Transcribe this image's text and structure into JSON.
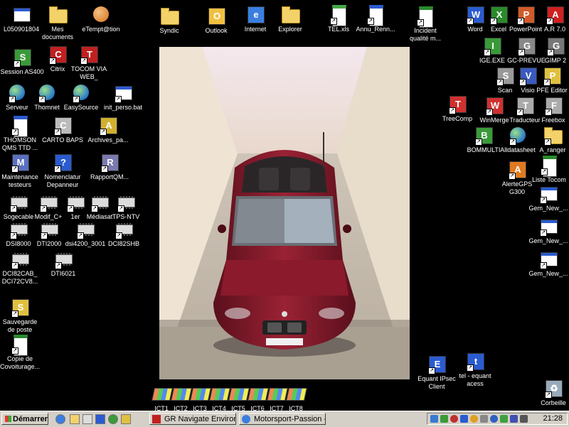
{
  "wallpaper": {
    "subject": "car-photo"
  },
  "icons": [
    {
      "id": "l050901804",
      "label": "L050901804",
      "glyph": "computer",
      "color": "#5b8de0"
    },
    {
      "id": "mes-documents",
      "label": "Mes\ndocuments",
      "glyph": "folder",
      "color": "#f3d26a"
    },
    {
      "id": "etemptation",
      "label": "eTempt@tion",
      "glyph": "people",
      "color": "#e0893a"
    },
    {
      "id": "syndic",
      "label": "Syndic",
      "glyph": "folder",
      "color": "#f3d26a"
    },
    {
      "id": "outlook",
      "label": "Outlook",
      "glyph": "tile",
      "color": "#f0c040",
      "letter": "O"
    },
    {
      "id": "internet",
      "label": "Internet",
      "glyph": "tile",
      "color": "#3b7ee0",
      "letter": "e"
    },
    {
      "id": "explorer",
      "label": "Explorer",
      "glyph": "folder",
      "color": "#f3d26a"
    },
    {
      "id": "tel-xls",
      "label": "TEL.xls",
      "glyph": "phone",
      "color": "#4a4"
    },
    {
      "id": "annu-renn",
      "label": "Annu_Renn...",
      "glyph": "doc",
      "color": "#2a5bd0"
    },
    {
      "id": "incident-qualite",
      "label": "Incident\nqualité m...",
      "glyph": "doc",
      "color": "#2a8a2a"
    },
    {
      "id": "word",
      "label": "Word",
      "glyph": "tile",
      "color": "#2a5bd0",
      "letter": "W"
    },
    {
      "id": "excel",
      "label": "Excel",
      "glyph": "tile",
      "color": "#2a8a2a",
      "letter": "X"
    },
    {
      "id": "powerpoint",
      "label": "PowerPoint",
      "glyph": "tile",
      "color": "#d05a2a",
      "letter": "P"
    },
    {
      "id": "ar70",
      "label": "A.R 7.0",
      "glyph": "tile",
      "color": "#d02020",
      "letter": "A"
    },
    {
      "id": "session-as400",
      "label": "Session AS400",
      "glyph": "tile",
      "color": "#3a9a3a",
      "letter": "S"
    },
    {
      "id": "citrix",
      "label": "Citrix",
      "glyph": "tile",
      "color": "#c02020",
      "letter": "C"
    },
    {
      "id": "tocom-web",
      "label": "TOCOM VIA\nWEB_",
      "glyph": "tile",
      "color": "#c02020",
      "letter": "T"
    },
    {
      "id": "ige-exe",
      "label": "IGE.EXE",
      "glyph": "tile",
      "color": "#3a9a3a",
      "letter": "I"
    },
    {
      "id": "gc-prevue",
      "label": "GC-PREVUE",
      "glyph": "tile",
      "color": "#888",
      "letter": "G"
    },
    {
      "id": "gimp2",
      "label": "GIMP 2",
      "glyph": "tile",
      "color": "#777",
      "letter": "G"
    },
    {
      "id": "scan",
      "label": "Scan",
      "glyph": "tile",
      "color": "#999",
      "letter": "S"
    },
    {
      "id": "visio",
      "label": "Visio",
      "glyph": "tile",
      "color": "#3a5ac0",
      "letter": "V"
    },
    {
      "id": "pfe-editor",
      "label": "PFE Editor",
      "glyph": "tile",
      "color": "#e0c040",
      "letter": "P"
    },
    {
      "id": "serveur",
      "label": "Serveur",
      "glyph": "globe",
      "color": "#2a78c8"
    },
    {
      "id": "thomnet",
      "label": "Thomnet",
      "glyph": "globe",
      "color": "#2a78c8"
    },
    {
      "id": "easysource",
      "label": "EasySource",
      "glyph": "globe",
      "color": "#2a78c8"
    },
    {
      "id": "init-perso",
      "label": "init_perso.bat",
      "glyph": "win",
      "color": "#2a5bd0"
    },
    {
      "id": "treecomp",
      "label": "TreeComp",
      "glyph": "tile",
      "color": "#d03030",
      "letter": "T"
    },
    {
      "id": "winmerge",
      "label": "WinMerge",
      "glyph": "tile",
      "color": "#d03030",
      "letter": "W"
    },
    {
      "id": "traducteur",
      "label": "Traducteur",
      "glyph": "tile",
      "color": "#aaa",
      "letter": "T"
    },
    {
      "id": "freebox",
      "label": "Freebox",
      "glyph": "tile",
      "color": "#aaa",
      "letter": "F"
    },
    {
      "id": "thomson-qms",
      "label": "THOMSON\nQMS TTD ...",
      "glyph": "doc",
      "color": "#2a5bd0"
    },
    {
      "id": "carto-baps",
      "label": "CARTO BAPS",
      "glyph": "tile",
      "color": "#bbb",
      "letter": "C"
    },
    {
      "id": "archives",
      "label": "Archives_pa...",
      "glyph": "tile",
      "color": "#d0b030",
      "letter": "A"
    },
    {
      "id": "bommulti",
      "label": "BOMMULTI",
      "glyph": "tile",
      "color": "#3a9a3a",
      "letter": "B"
    },
    {
      "id": "alldatasheet",
      "label": "Alldatasheet",
      "glyph": "globe",
      "color": "#2a78c8"
    },
    {
      "id": "a-ranger",
      "label": "A_ranger",
      "glyph": "folder",
      "color": "#f3d26a"
    },
    {
      "id": "maintenance",
      "label": "Maintenance\ntesteurs",
      "glyph": "tile",
      "color": "#5a70c0",
      "letter": "M"
    },
    {
      "id": "nomenclatur",
      "label": "Nomenclatur\nDepanneur",
      "glyph": "tile",
      "color": "#2a5bd0",
      "letter": "?"
    },
    {
      "id": "rapportqm",
      "label": "RapportQM...",
      "glyph": "tile",
      "color": "#7a7ab0",
      "letter": "R"
    },
    {
      "id": "alertegps",
      "label": "AlerteGPS\nG300",
      "glyph": "tile",
      "color": "#e07a20",
      "letter": "A"
    },
    {
      "id": "liste-tocom",
      "label": "Liste Tocom",
      "glyph": "doc",
      "color": "#2a8a2a"
    },
    {
      "id": "sogecable",
      "label": "Sogecable",
      "glyph": "chip",
      "color": "#ccc"
    },
    {
      "id": "modif-c",
      "label": "Modif_C+",
      "glyph": "chip",
      "color": "#ccc"
    },
    {
      "id": "1er",
      "label": "1er",
      "glyph": "chip",
      "color": "#ccc"
    },
    {
      "id": "mediasat",
      "label": "Médiasat",
      "glyph": "chip",
      "color": "#ccc"
    },
    {
      "id": "tps-ntv",
      "label": "TPS-NTV",
      "glyph": "chip",
      "color": "#ccc"
    },
    {
      "id": "gem-new-1",
      "label": "Gem_New_...",
      "glyph": "win",
      "color": "#888"
    },
    {
      "id": "dsi8000",
      "label": "DSI8000",
      "glyph": "chip",
      "color": "#ccc"
    },
    {
      "id": "dti2000",
      "label": "DTI2000",
      "glyph": "chip",
      "color": "#ccc"
    },
    {
      "id": "dsi4200",
      "label": "dsi4200_3001",
      "glyph": "chip",
      "color": "#ccc"
    },
    {
      "id": "dci82shb",
      "label": "DCI82SHB",
      "glyph": "chip",
      "color": "#ccc"
    },
    {
      "id": "gem-new-2",
      "label": "Gem_New_...",
      "glyph": "win",
      "color": "#888"
    },
    {
      "id": "dci82cab",
      "label": "DCI82CAB_\nDCI72CV8...",
      "glyph": "chip",
      "color": "#ccc"
    },
    {
      "id": "dti6021",
      "label": "DTI6021",
      "glyph": "chip",
      "color": "#ccc"
    },
    {
      "id": "gem-new-3",
      "label": "Gem_New_...",
      "glyph": "win",
      "color": "#888"
    },
    {
      "id": "sauvegarde",
      "label": "Sauvegarde\nde poste",
      "glyph": "tile",
      "color": "#e0c040",
      "letter": "S"
    },
    {
      "id": "copie-covoiturage",
      "label": "Copie de\nCovoiturage...",
      "glyph": "doc",
      "color": "#2a8a2a"
    },
    {
      "id": "equant-ipsec",
      "label": "Equant IPsec\nClient",
      "glyph": "tile",
      "color": "#2a5bd0",
      "letter": "E"
    },
    {
      "id": "tel-equant",
      "label": "tel - equant\nacess",
      "glyph": "tile",
      "color": "#2a5bd0",
      "letter": "t"
    },
    {
      "id": "ict1",
      "label": "ICT1",
      "glyph": "ict",
      "color": "#ccc"
    },
    {
      "id": "ict2",
      "label": "ICT2",
      "glyph": "ict",
      "color": "#ccc"
    },
    {
      "id": "ict3",
      "label": "ICT3",
      "glyph": "ict",
      "color": "#ccc"
    },
    {
      "id": "ict4",
      "label": "ICT4",
      "glyph": "ict",
      "color": "#ccc"
    },
    {
      "id": "ict5",
      "label": "ICT5",
      "glyph": "ict",
      "color": "#ccc"
    },
    {
      "id": "ict6",
      "label": "ICT6",
      "glyph": "ict",
      "color": "#ccc"
    },
    {
      "id": "ict7",
      "label": "ICT7",
      "glyph": "ict",
      "color": "#ccc"
    },
    {
      "id": "ict8",
      "label": "ICT8",
      "glyph": "ict",
      "color": "#ccc"
    },
    {
      "id": "corbeille",
      "label": "Corbeille",
      "glyph": "tile",
      "color": "#9ab",
      "letter": "♻"
    }
  ],
  "taskbar": {
    "start_label": "Démarrer",
    "tasks": [
      {
        "label": "GR Navigate Environ...",
        "icon_color": "#c02020"
      },
      {
        "label": "Motorsport-Passion -...",
        "icon_color": "#3b7ee0"
      }
    ],
    "clock": "21:28"
  }
}
